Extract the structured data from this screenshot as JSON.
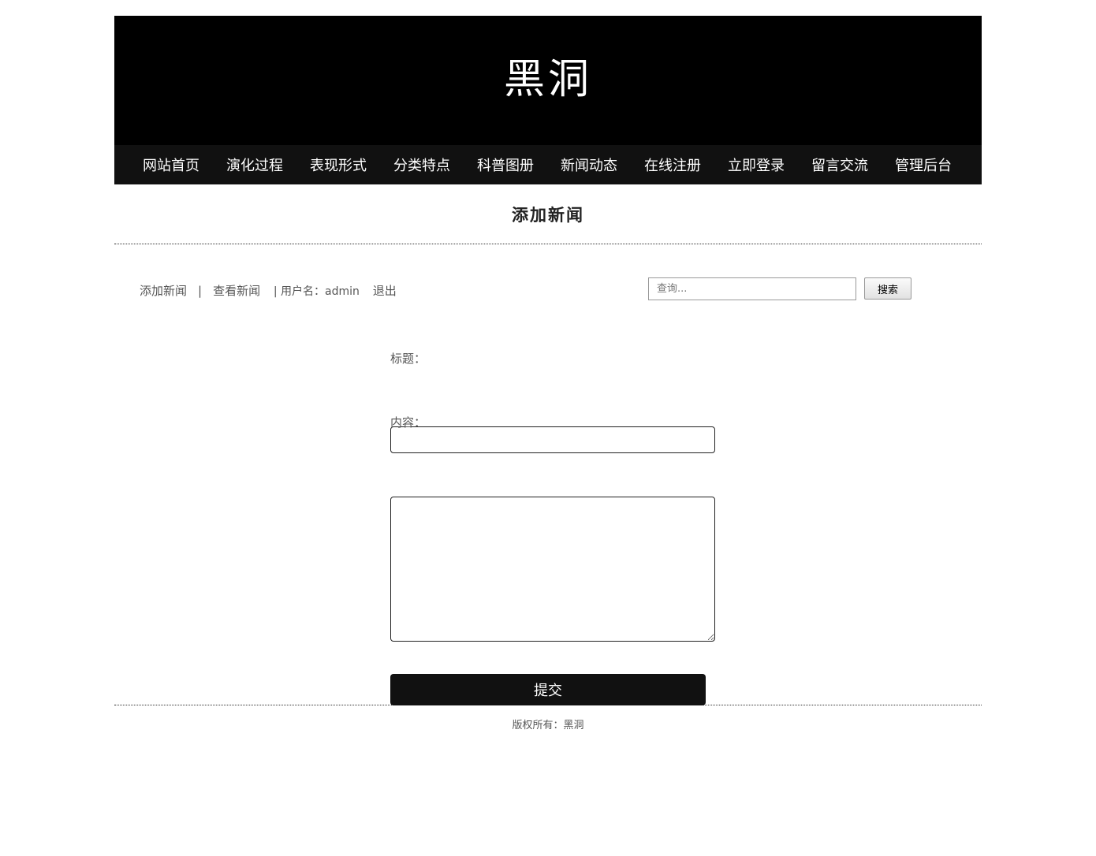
{
  "site": {
    "title": "黑洞"
  },
  "nav": {
    "items": [
      {
        "label": "网站首页"
      },
      {
        "label": "演化过程"
      },
      {
        "label": "表现形式"
      },
      {
        "label": "分类特点"
      },
      {
        "label": "科普图册"
      },
      {
        "label": "新闻动态"
      },
      {
        "label": "在线注册"
      },
      {
        "label": "立即登录"
      },
      {
        "label": "留言交流"
      },
      {
        "label": "管理后台"
      }
    ]
  },
  "page": {
    "title": "添加新闻"
  },
  "toolbar": {
    "add_news": "添加新闻",
    "separator": "|",
    "view_news": "查看新闻",
    "user_label": "| 用户名：admin",
    "logout": "退出",
    "search_placeholder": "查询...",
    "search_value": "",
    "search_button": "搜索"
  },
  "form": {
    "title_label": "标题：",
    "title_value": "",
    "content_label": "内容：",
    "content_value": "",
    "submit_label": "提交"
  },
  "footer": {
    "text": "版权所有：黑洞"
  },
  "colors": {
    "header_bg": "#000000",
    "nav_bg": "#111111",
    "button_bg": "#111111"
  }
}
